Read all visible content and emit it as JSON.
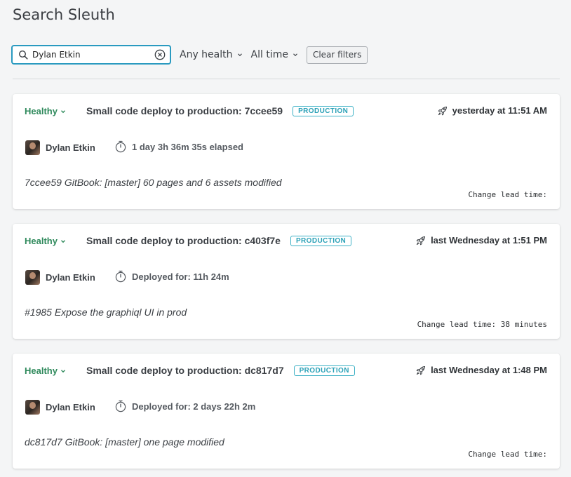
{
  "page": {
    "title": "Search Sleuth"
  },
  "filters": {
    "search_value": "Dylan Etkin",
    "health_label": "Any health",
    "time_label": "All time",
    "clear_label": "Clear filters"
  },
  "deploys": [
    {
      "health": "Healthy",
      "title": "Small code deploy to production: 7ccee59",
      "environment": "PRODUCTION",
      "time": "yesterday at 11:51 AM",
      "author": "Dylan Etkin",
      "duration": "1 day 3h 36m 35s elapsed",
      "description": "7ccee59 GitBook: [master] 60 pages and 6 assets modified",
      "lead_time": "Change lead time:"
    },
    {
      "health": "Healthy",
      "title": "Small code deploy to production: c403f7e",
      "environment": "PRODUCTION",
      "time": "last Wednesday at 1:51 PM",
      "author": "Dylan Etkin",
      "duration": "Deployed for: 11h 24m",
      "description": "#1985 Expose the graphiql UI in prod",
      "lead_time": "Change lead time: 38 minutes"
    },
    {
      "health": "Healthy",
      "title": "Small code deploy to production: dc817d7",
      "environment": "PRODUCTION",
      "time": "last Wednesday at 1:48 PM",
      "author": "Dylan Etkin",
      "duration": "Deployed for: 2 days 22h 2m",
      "description": "dc817d7 GitBook: [master] one page modified",
      "lead_time": "Change lead time:"
    }
  ],
  "colors": {
    "accent": "#2a9ac0",
    "healthy": "#2f8a5c",
    "badge": "#2ba1b7"
  },
  "icons": [
    "search-icon",
    "clear-icon",
    "chevron-down-icon",
    "rocket-icon",
    "timer-icon"
  ]
}
